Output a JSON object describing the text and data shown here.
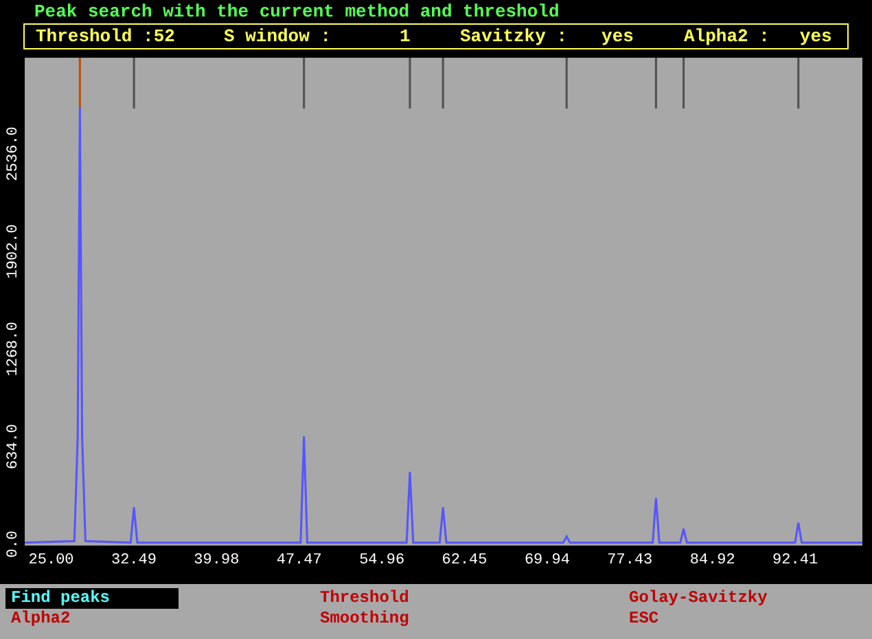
{
  "title": "Peak search with the current method and threshold",
  "settings": [
    {
      "label": "Threshold :",
      "value": "52"
    },
    {
      "label": "S window :",
      "value": "1"
    },
    {
      "label": "Savitzky :",
      "value": "yes"
    },
    {
      "label": "Alpha2 :",
      "value": "yes"
    }
  ],
  "chart": {
    "chart_data": {
      "type": "line",
      "xlim": [
        22.6,
        98.5
      ],
      "ylim": [
        0,
        3160
      ],
      "xticks": [
        {
          "value": 25,
          "label": "25.00"
        },
        {
          "value": 32.49,
          "label": "32.49"
        },
        {
          "value": 39.98,
          "label": "39.98"
        },
        {
          "value": 47.47,
          "label": "47.47"
        },
        {
          "value": 54.96,
          "label": "54.96"
        },
        {
          "value": 62.45,
          "label": "62.45"
        },
        {
          "value": 69.94,
          "label": "69.94"
        },
        {
          "value": 77.43,
          "label": "77.43"
        },
        {
          "value": 84.92,
          "label": "84.92"
        },
        {
          "value": 92.41,
          "label": "92.41"
        }
      ],
      "yticks": [
        {
          "value": 0,
          "label": "0.0"
        },
        {
          "value": 634,
          "label": "634.0"
        },
        {
          "value": 1268,
          "label": "1268.0"
        },
        {
          "value": 1902,
          "label": "1902.0"
        },
        {
          "value": 2536,
          "label": "2536.0"
        }
      ],
      "x": [
        22.6,
        27.1,
        27.4,
        27.6,
        27.8,
        28.1,
        32.2,
        32.5,
        32.8,
        47.6,
        47.9,
        48.2,
        57.2,
        57.5,
        57.8,
        60.2,
        60.5,
        60.8,
        71.4,
        71.7,
        72.0,
        79.5,
        79.8,
        80.1,
        82.0,
        82.3,
        82.6,
        92.4,
        92.7,
        93.0,
        98.5
      ],
      "series": [
        {
          "color": "#5555ff",
          "values": [
            10,
            20,
            700,
            2840,
            700,
            20,
            10,
            240,
            10,
            10,
            700,
            10,
            10,
            470,
            10,
            10,
            240,
            10,
            10,
            50,
            10,
            10,
            300,
            10,
            10,
            100,
            10,
            10,
            140,
            10,
            10
          ]
        }
      ]
    },
    "peak_markers": [
      {
        "selected": true
      },
      {
        "selected": false
      },
      {
        "selected": false
      },
      {
        "selected": false
      },
      {
        "selected": false
      },
      {
        "selected": false
      },
      {
        "selected": false
      },
      {
        "selected": false
      },
      {
        "selected": false
      }
    ]
  },
  "menu": [
    {
      "label": "Find peaks",
      "selected": true
    },
    {
      "label": "Threshold",
      "selected": false
    },
    {
      "label": "Golay-Savitzky",
      "selected": false
    },
    {
      "label": "Alpha2",
      "selected": false
    },
    {
      "label": "Smoothing",
      "selected": false
    },
    {
      "label": "ESC",
      "selected": false
    }
  ]
}
